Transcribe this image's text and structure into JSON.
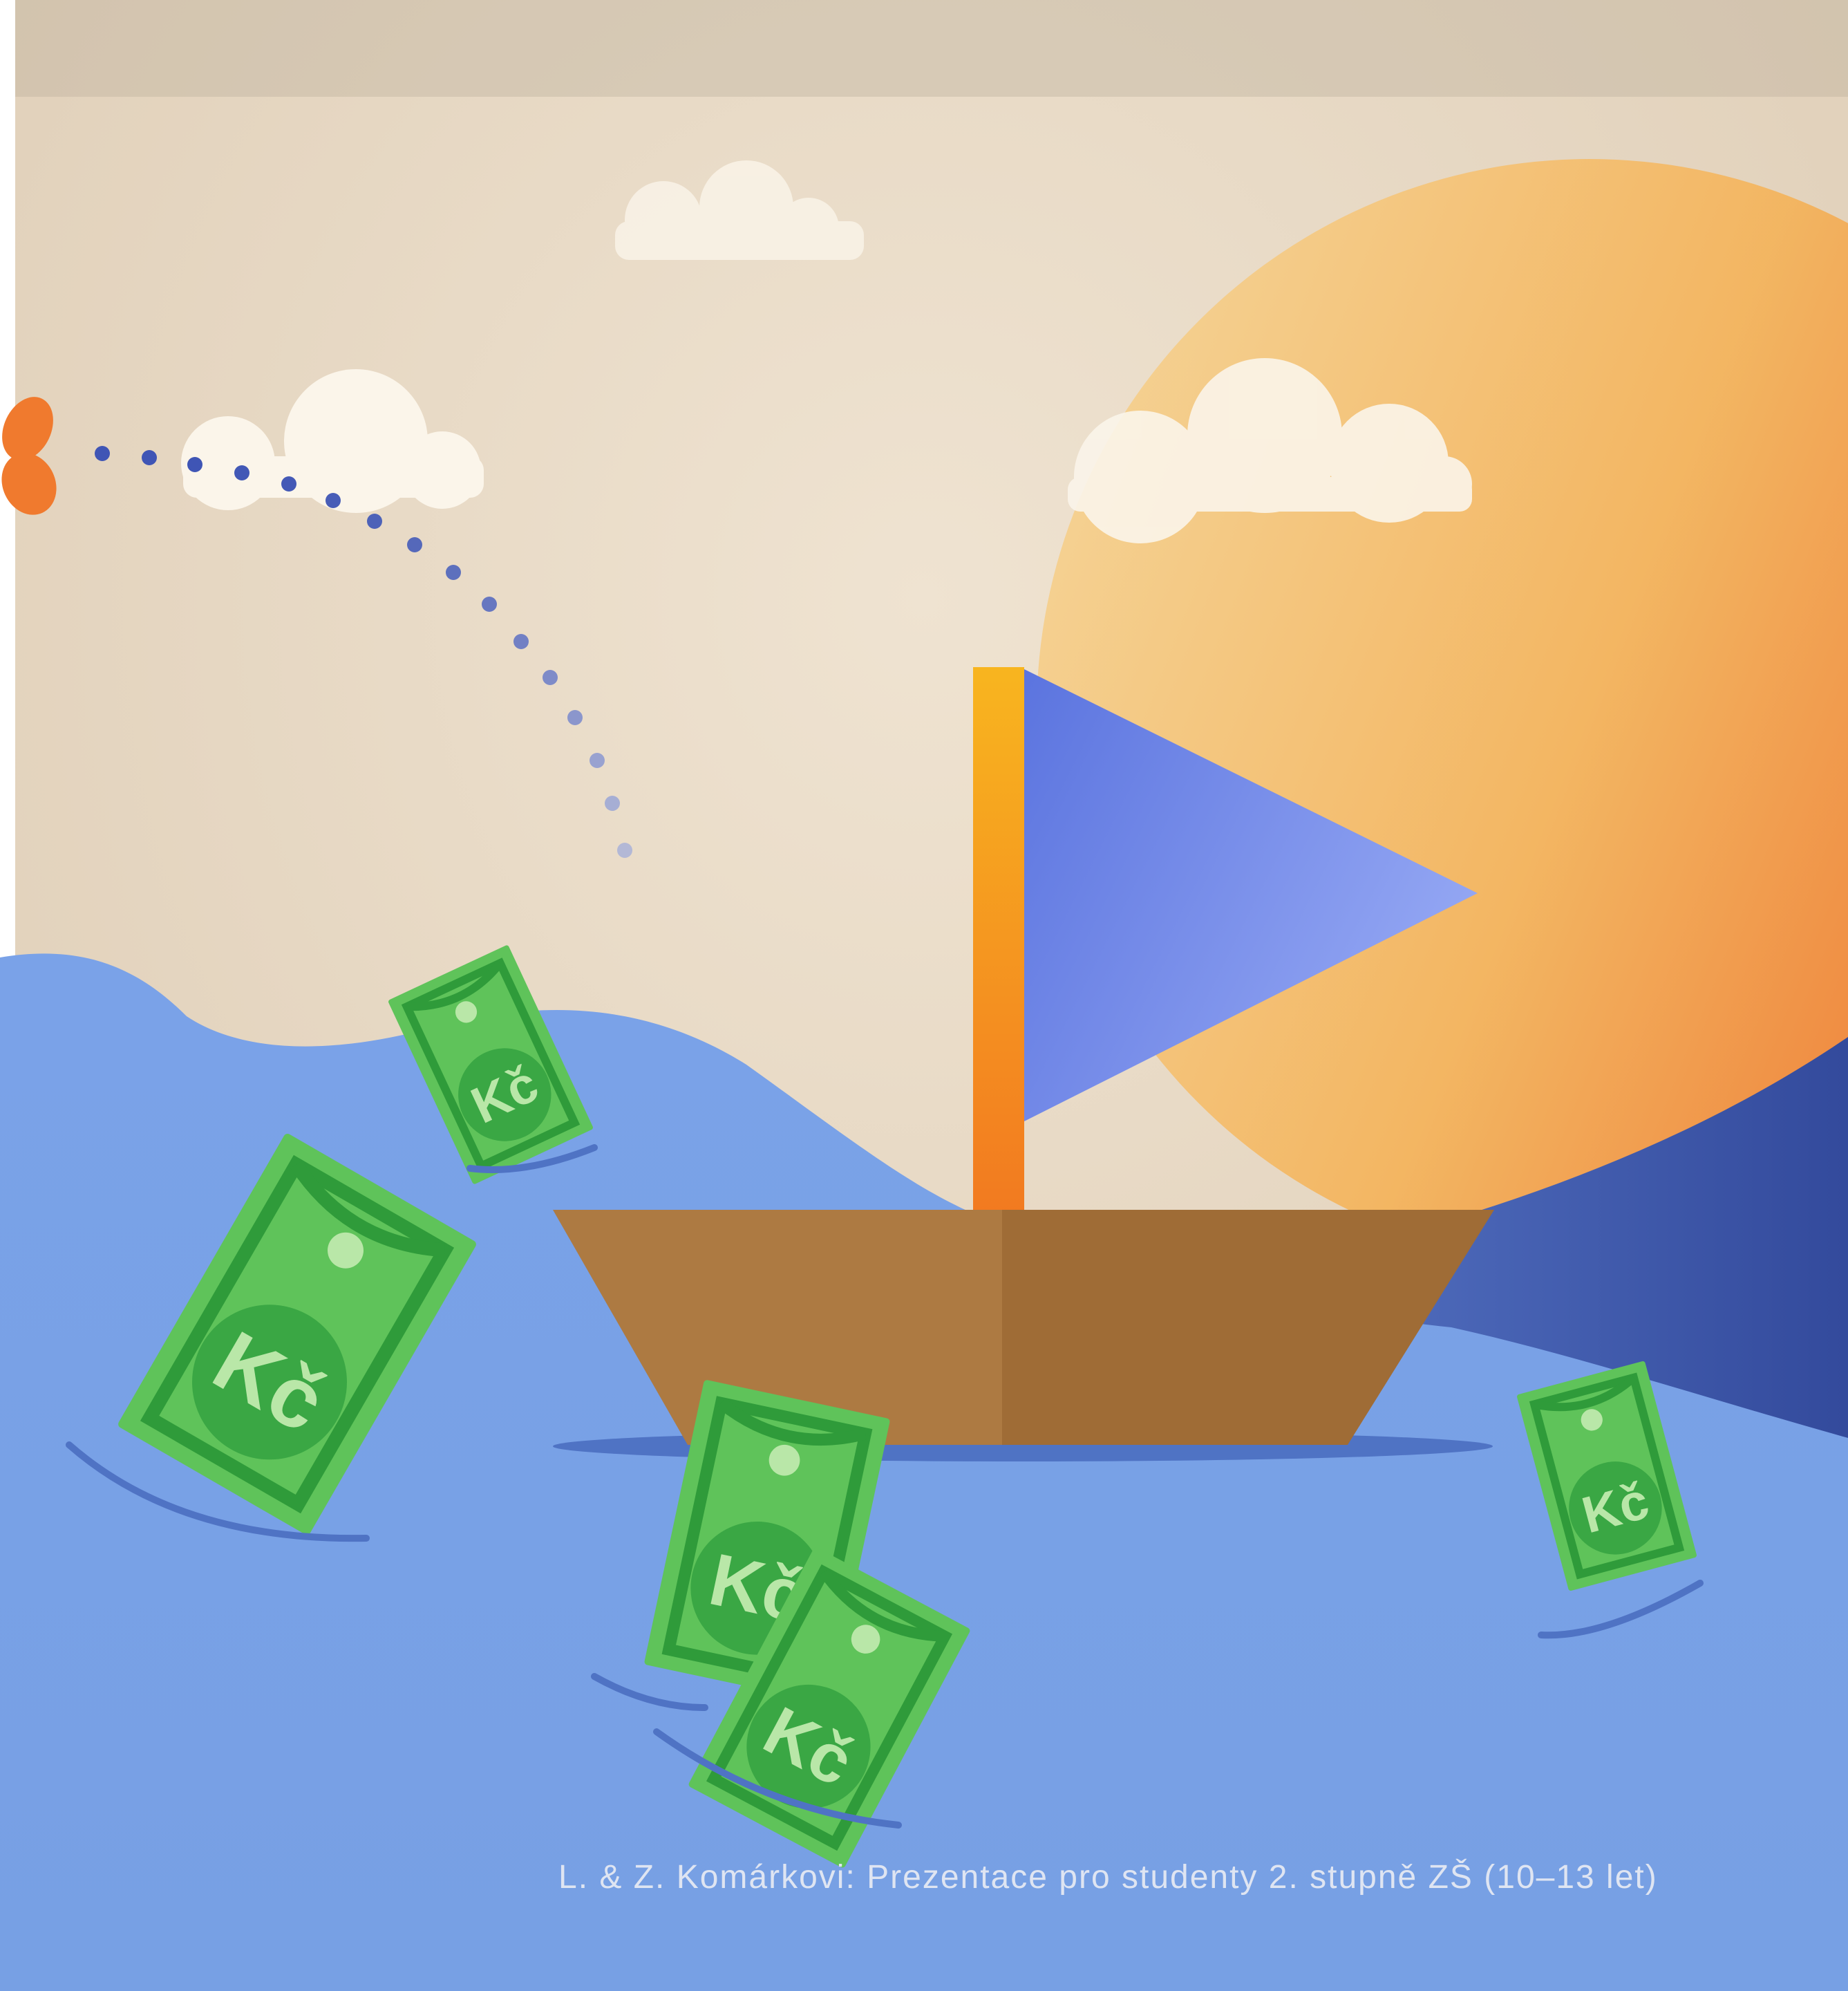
{
  "caption": "L. & Z. Komárkovi: Prezentace pro studenty 2. stupně ZŠ (10–13 let)",
  "banknote_label": "Kč",
  "colors": {
    "paper": "#eadcc9",
    "sea": "#76a0e6",
    "sea_dark": "#4f6fb9",
    "banknote": "#5fc35a",
    "banknote_dark": "#2f9b3a",
    "hull": "#b0793f",
    "mast": "#f6a51c",
    "sail": "#7790ec",
    "sun": "#f4b35a",
    "cloud": "#fbf5ea",
    "dots": "#3f55b5"
  }
}
